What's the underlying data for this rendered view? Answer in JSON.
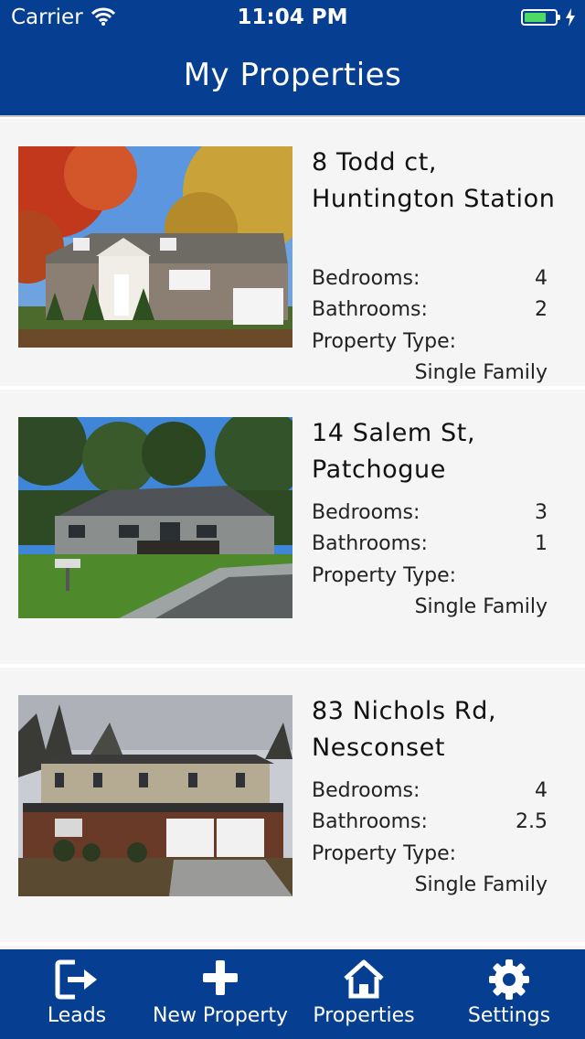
{
  "status_bar": {
    "carrier": "Carrier",
    "time": "11:04 PM",
    "battery_level": 0.74,
    "battery_color": "#4cd964"
  },
  "nav": {
    "title": "My Properties",
    "background": "#063f92"
  },
  "labels": {
    "bedrooms": "Bedrooms:",
    "bathrooms": "Bathrooms:",
    "property_type": "Property Type:"
  },
  "properties": [
    {
      "address": "8 Todd ct, Huntington Station",
      "bedrooms": "4",
      "bathrooms": "2",
      "property_type": "Single Family",
      "photo_icon": "house-photo"
    },
    {
      "address": "14 Salem St, Patchogue",
      "bedrooms": "3",
      "bathrooms": "1",
      "property_type": "Single Family",
      "photo_icon": "house-photo"
    },
    {
      "address": "83 Nichols Rd, Nesconset",
      "bedrooms": "4",
      "bathrooms": "2.5",
      "property_type": "Single Family",
      "photo_icon": "house-photo"
    }
  ],
  "tab_bar": {
    "tabs": [
      {
        "label": "Leads",
        "icon": "logout-icon"
      },
      {
        "label": "New Property",
        "icon": "plus-icon"
      },
      {
        "label": "Properties",
        "icon": "home-icon"
      },
      {
        "label": "Settings",
        "icon": "gear-icon"
      }
    ]
  }
}
